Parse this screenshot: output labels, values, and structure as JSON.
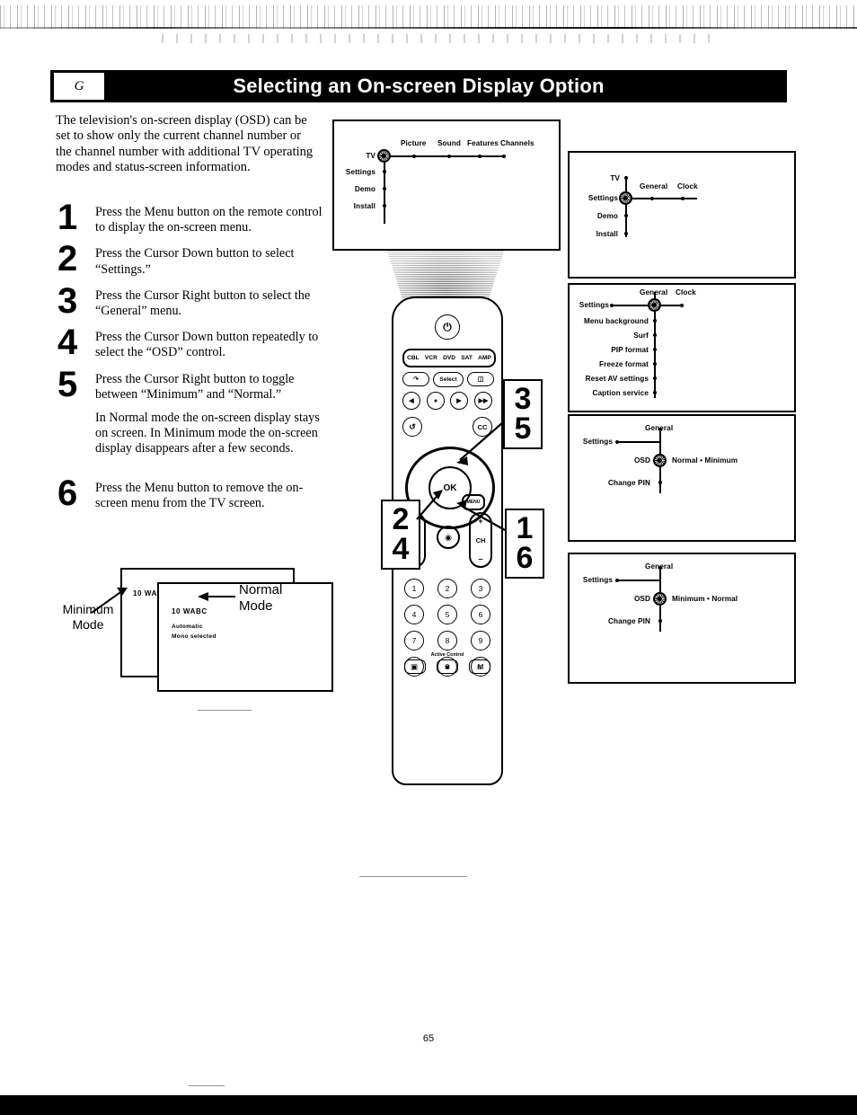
{
  "header": {
    "section_tag": "G",
    "title": "Selecting an On-screen Display Option"
  },
  "intro": "The television's on-screen display (OSD) can be set to show only the current channel number or the channel number with additional TV operating modes and status-screen information.",
  "steps": [
    {
      "num": "1",
      "text": "Press the Menu button on the remote control to display the on-screen menu."
    },
    {
      "num": "2",
      "text": "Press the Cursor Down button to select “Settings.”"
    },
    {
      "num": "3",
      "text": "Press the Cursor Right button to select the “General” menu."
    },
    {
      "num": "4",
      "text": "Press the Cursor Down button repeatedly to select the “OSD” control."
    },
    {
      "num": "5",
      "text": "Press the Cursor Right button to toggle between “Minimum” and “Normal.”",
      "sub": "In Normal mode the on-screen display stays on screen. In Minimum mode the on-screen display disappears after a few seconds."
    },
    {
      "num": "6",
      "text": "Press the Menu button to remove the on-screen menu from the TV screen."
    }
  ],
  "osd_main": {
    "selected": "TV",
    "column": [
      "TV",
      "Settings",
      "Demo",
      "Install"
    ],
    "row": [
      "Picture",
      "Sound",
      "Features",
      "Channels"
    ]
  },
  "osd_panel1": {
    "selected": "Settings",
    "column": [
      "TV",
      "Settings",
      "Demo",
      "Install"
    ],
    "row": [
      "General",
      "Clock"
    ]
  },
  "osd_panel2": {
    "selected": "General",
    "row": [
      "General",
      "Clock"
    ],
    "column": [
      "Settings",
      "Menu background",
      "Surf",
      "PIP format",
      "Freeze format",
      "Reset AV settings",
      "Caption service"
    ]
  },
  "osd_panel3": {
    "selected": "OSD",
    "parent": "Settings",
    "branch": "General",
    "items": [
      "OSD",
      "Change PIN"
    ],
    "values": "Normal • Minimum"
  },
  "osd_panel4": {
    "selected": "OSD",
    "parent": "Settings",
    "branch": "General",
    "items": [
      "OSD",
      "Change PIN"
    ],
    "values": "Minimum • Normal"
  },
  "mode_figure": {
    "minimum_label": "Minimum\nMode",
    "minimum_label_l1": "Minimum",
    "minimum_label_l2": "Mode",
    "normal_label_l1": "Normal",
    "normal_label_l2": "Mode",
    "back_screen_channel": "10  WABC",
    "front_screen_channel": "10  WABC",
    "front_screen_line2": "Automatic",
    "front_screen_line3": "Mono selected"
  },
  "remote": {
    "power_icon": "power-icon",
    "device_buttons": [
      "CBL",
      "VCR",
      "DVD",
      "SAT",
      "AMP"
    ],
    "select_label": "Select",
    "ok_label": "OK",
    "menu_label": "MENU",
    "vol_plus": "+",
    "vol_minus": "–",
    "vol_icon": "◢",
    "ch_plus": "+",
    "ch_label": "CH",
    "ch_minus": "–",
    "mute_icon": "◉",
    "cc_label": "CC",
    "active_control_label": "Active Control",
    "keypad": [
      [
        "1",
        "2",
        "3"
      ],
      [
        "4",
        "5",
        "6"
      ],
      [
        "7",
        "8",
        "9"
      ],
      [
        "▣",
        "0",
        "M"
      ]
    ]
  },
  "callouts": {
    "c35_top": "3",
    "c35_bottom": "5",
    "c16_top": "1",
    "c16_bottom": "6",
    "c24_top": "2",
    "c24_bottom": "4"
  },
  "page_number": "65"
}
